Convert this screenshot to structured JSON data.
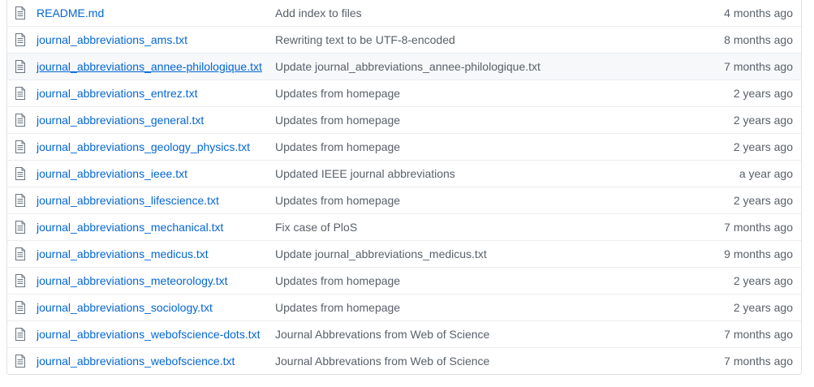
{
  "files": [
    {
      "name": "README.md",
      "message": "Add index to files",
      "age": "4 months ago"
    },
    {
      "name": "journal_abbreviations_ams.txt",
      "message": "Rewriting text to be UTF-8-encoded",
      "age": "8 months ago"
    },
    {
      "name": "journal_abbreviations_annee-philologique.txt",
      "message": "Update journal_abbreviations_annee-philologique.txt",
      "age": "7 months ago"
    },
    {
      "name": "journal_abbreviations_entrez.txt",
      "message": "Updates from homepage",
      "age": "2 years ago"
    },
    {
      "name": "journal_abbreviations_general.txt",
      "message": "Updates from homepage",
      "age": "2 years ago"
    },
    {
      "name": "journal_abbreviations_geology_physics.txt",
      "message": "Updates from homepage",
      "age": "2 years ago"
    },
    {
      "name": "journal_abbreviations_ieee.txt",
      "message": "Updated IEEE journal abbreviations",
      "age": "a year ago"
    },
    {
      "name": "journal_abbreviations_lifescience.txt",
      "message": "Updates from homepage",
      "age": "2 years ago"
    },
    {
      "name": "journal_abbreviations_mechanical.txt",
      "message": "Fix case of PloS",
      "age": "7 months ago"
    },
    {
      "name": "journal_abbreviations_medicus.txt",
      "message": "Update journal_abbreviations_medicus.txt",
      "age": "9 months ago"
    },
    {
      "name": "journal_abbreviations_meteorology.txt",
      "message": "Updates from homepage",
      "age": "2 years ago"
    },
    {
      "name": "journal_abbreviations_sociology.txt",
      "message": "Updates from homepage",
      "age": "2 years ago"
    },
    {
      "name": "journal_abbreviations_webofscience-dots.txt",
      "message": "Journal Abbrevations from Web of Science",
      "age": "7 months ago"
    },
    {
      "name": "journal_abbreviations_webofscience.txt",
      "message": "Journal Abbrevations from Web of Science",
      "age": "7 months ago"
    }
  ],
  "hovered_row": 2,
  "icon": "file-text-icon",
  "colors": {
    "link": "#0366d6",
    "muted": "#586069",
    "hover_bg": "#f6f8fa",
    "border": "#eaecef"
  }
}
